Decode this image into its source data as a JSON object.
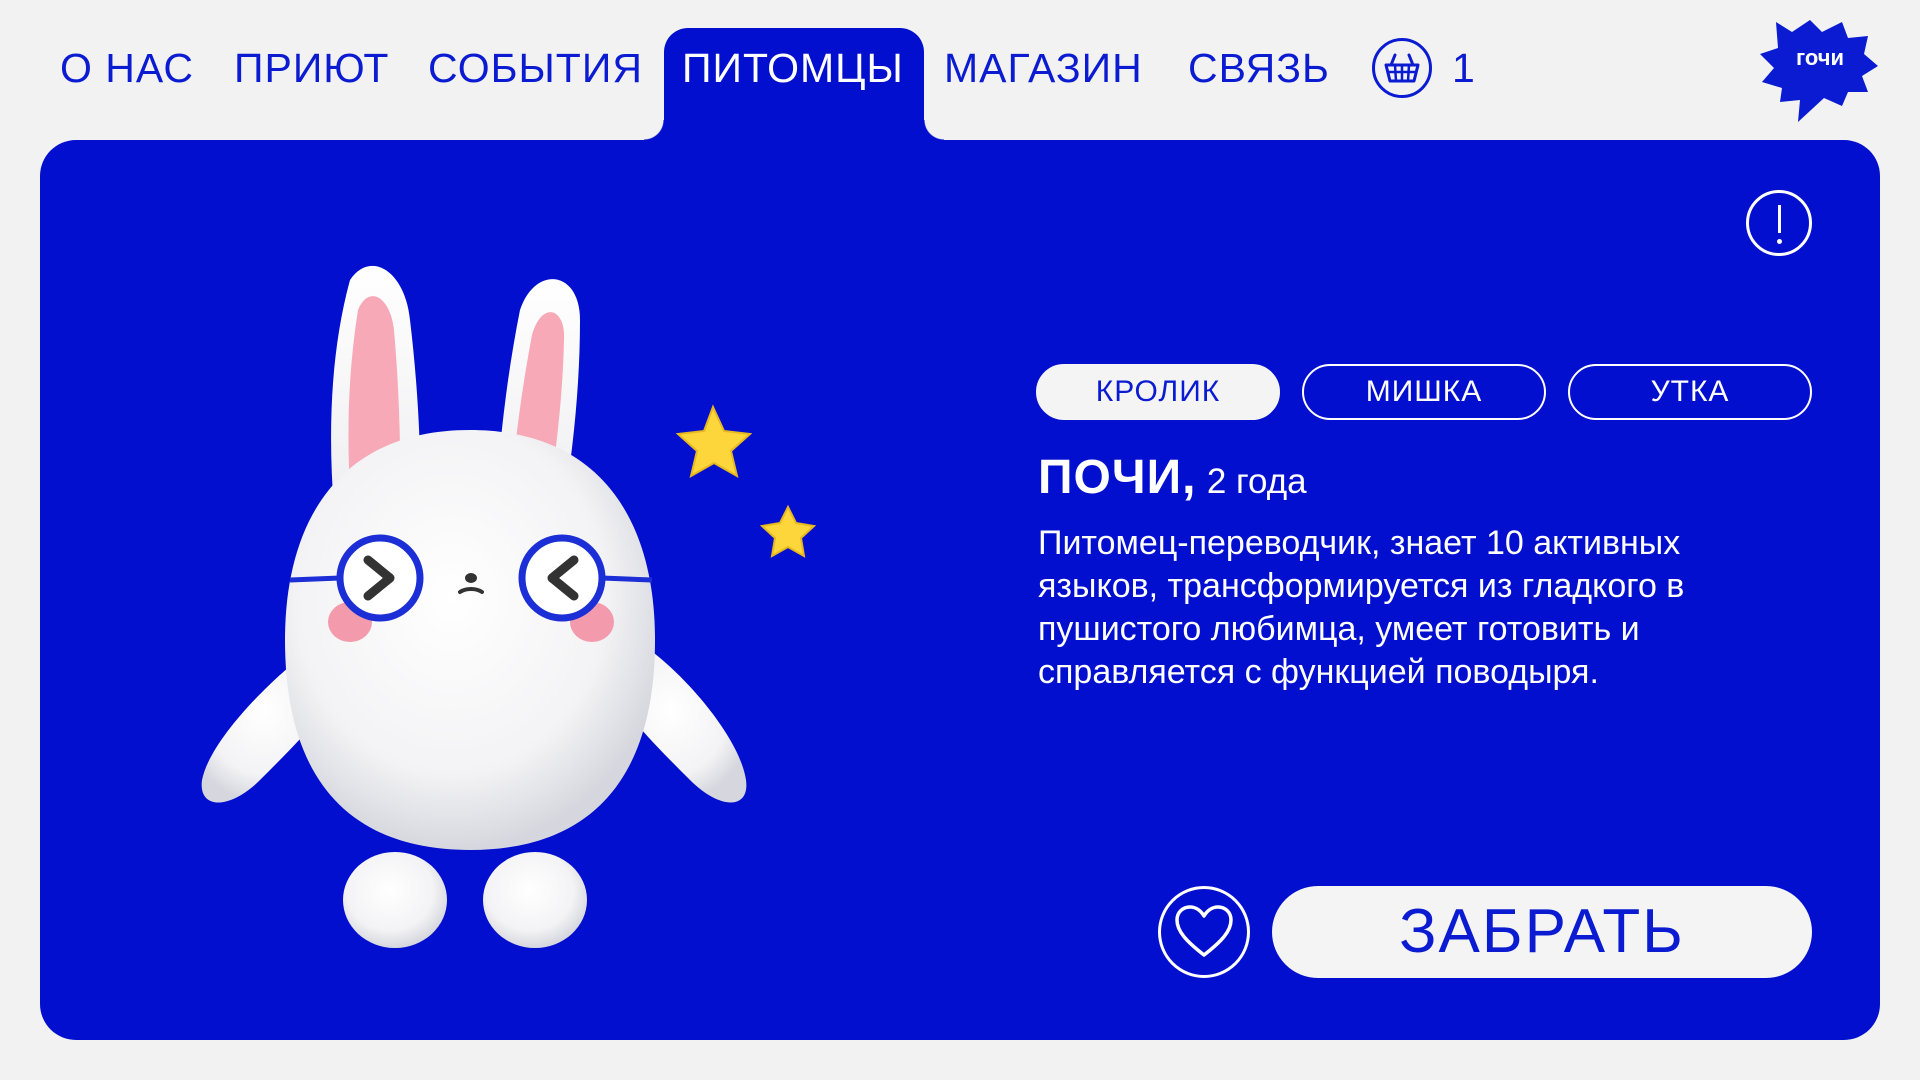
{
  "nav": {
    "items": [
      {
        "label": "О НАС",
        "active": false
      },
      {
        "label": "ПРИЮТ",
        "active": false
      },
      {
        "label": "СОБЫТИЯ",
        "active": false
      },
      {
        "label": "ПИТОМЦЫ",
        "active": true
      },
      {
        "label": "МАГАЗИН",
        "active": false
      },
      {
        "label": "СВЯЗЬ",
        "active": false
      }
    ],
    "cart": {
      "icon": "basket-icon",
      "count": "1"
    },
    "logo": {
      "text": "гочи",
      "icon": "speech-burst-logo"
    }
  },
  "pet_types": [
    {
      "label": "КРОЛИК",
      "selected": true
    },
    {
      "label": "МИШКА",
      "selected": false
    },
    {
      "label": "УТКА",
      "selected": false
    }
  ],
  "pet": {
    "name": "ПОЧИ,",
    "age": "2 года",
    "description": "Питомец-переводчик, знает 10 активных языков, трансформируется из гладкого в пушистого любимца, умеет готовить и справляется с функцией поводыря."
  },
  "actions": {
    "favorite_icon": "heart-icon",
    "take_label": "ЗАБРАТЬ",
    "info_icon": "exclamation-icon"
  },
  "colors": {
    "brand_blue": "#030fcf",
    "nav_text": "#0a1bd1",
    "background": "#f2f2f2",
    "star": "#fcd63a",
    "ear_pink": "#f7a9b8"
  }
}
